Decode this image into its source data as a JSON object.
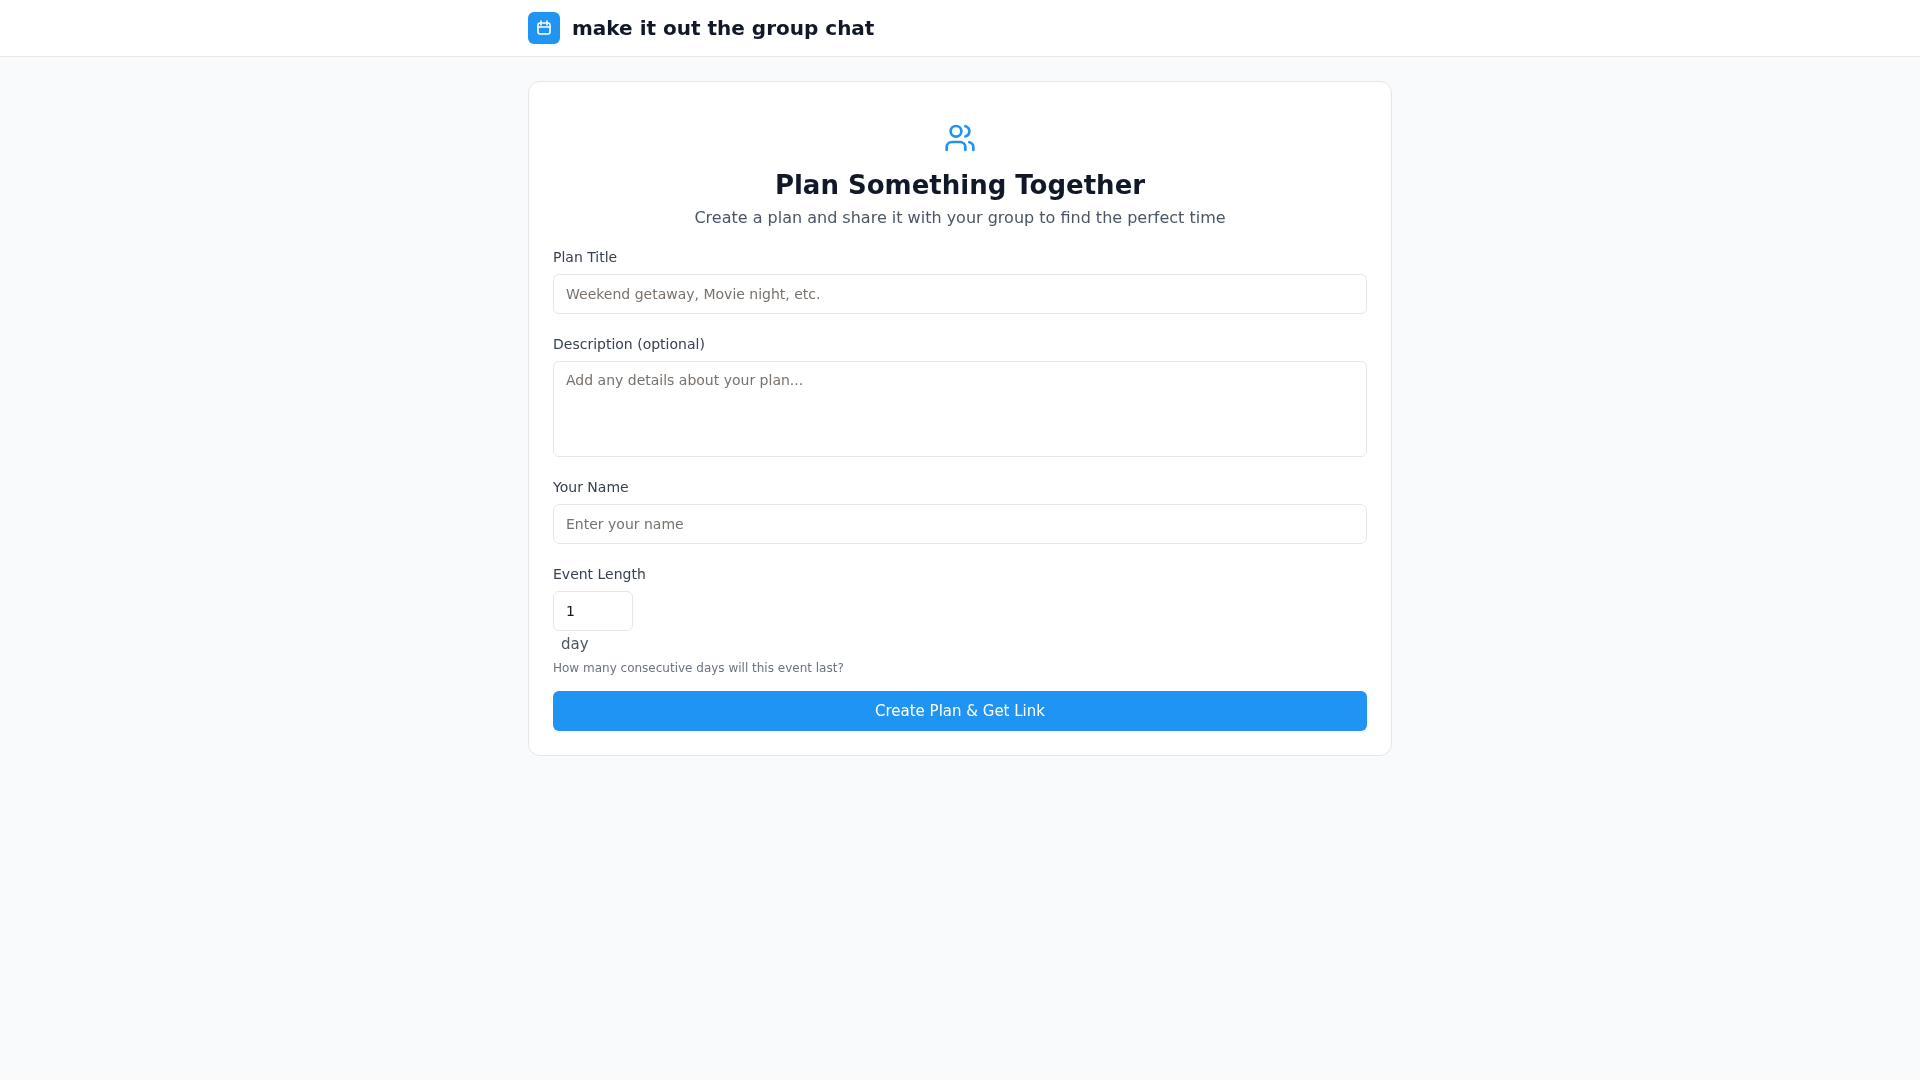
{
  "header": {
    "title": "make it out the group chat"
  },
  "card": {
    "heading": "Plan Something Together",
    "subtitle": "Create a plan and share it with your group to find the perfect time",
    "fields": [
      {
        "kind": "text",
        "label": "Plan Title",
        "placeholder": "Weekend getaway, Movie night, etc."
      },
      {
        "kind": "textarea",
        "label": "Description (optional)",
        "placeholder": "Add any details about your plan..."
      },
      {
        "kind": "text",
        "label": "Your Name",
        "placeholder": "Enter your name"
      },
      {
        "kind": "number",
        "label": "Event Length",
        "value": "1",
        "unit": "day",
        "hint": "How many consecutive days will this event last?"
      }
    ],
    "submit": "Create Plan & Get Link"
  }
}
